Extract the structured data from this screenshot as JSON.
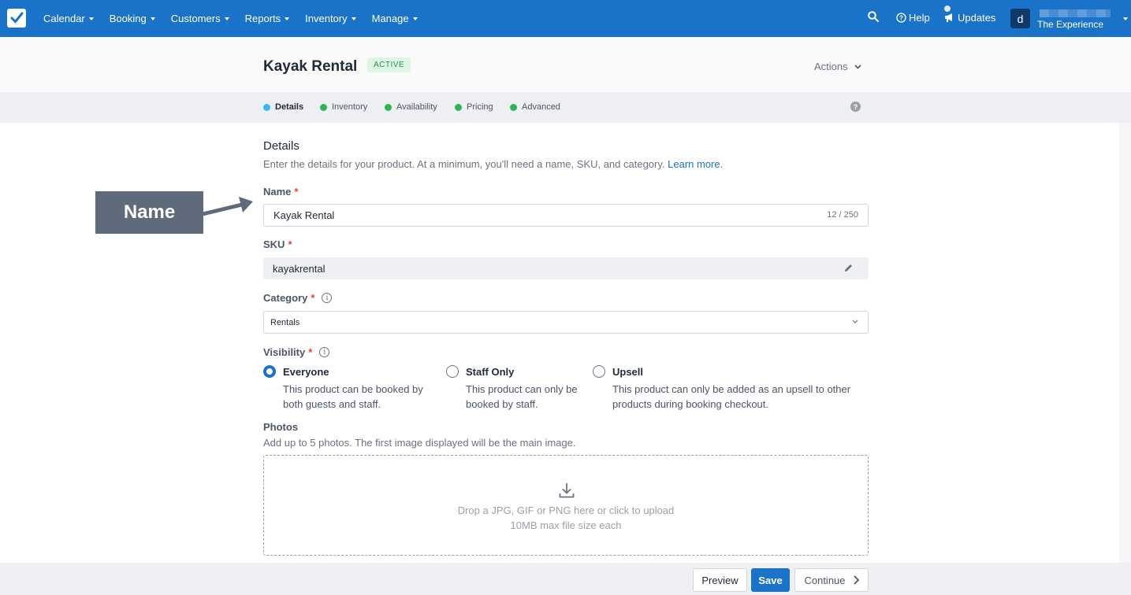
{
  "nav": {
    "items": [
      {
        "label": "Calendar",
        "name": "nav-calendar"
      },
      {
        "label": "Booking",
        "name": "nav-booking"
      },
      {
        "label": "Customers",
        "name": "nav-customers"
      },
      {
        "label": "Reports",
        "name": "nav-reports"
      },
      {
        "label": "Inventory",
        "name": "nav-inventory"
      },
      {
        "label": "Manage",
        "name": "nav-manage"
      }
    ],
    "help": "Help",
    "updates": "Updates",
    "avatar_letter": "d",
    "account_name": "The Experience"
  },
  "header": {
    "title": "Kayak Rental",
    "status": "ACTIVE",
    "actions": "Actions"
  },
  "steps": [
    {
      "label": "Details",
      "color": "#3fb6f0",
      "active": true
    },
    {
      "label": "Inventory",
      "color": "#2fb553",
      "active": false
    },
    {
      "label": "Availability",
      "color": "#2fb553",
      "active": false
    },
    {
      "label": "Pricing",
      "color": "#2fb553",
      "active": false
    },
    {
      "label": "Advanced",
      "color": "#2fb553",
      "active": false
    }
  ],
  "help_icon": "?",
  "details": {
    "title": "Details",
    "description": "Enter the details for your product. At a minimum, you'll need a name, SKU, and category.",
    "learn_more": "Learn more",
    "period": "."
  },
  "form": {
    "required_mark": "*",
    "info_icon": "i",
    "name_label": "Name",
    "name_value": "Kayak Rental",
    "name_counter": "12 / 250",
    "sku_label": "SKU",
    "sku_value": "kayakrental",
    "category_label": "Category",
    "category_value": "Rentals",
    "visibility_label": "Visibility",
    "visibility_options": [
      {
        "title": "Everyone",
        "desc_1": "This product can be booked by",
        "desc_2": "both guests and staff.",
        "checked": true
      },
      {
        "title": "Staff Only",
        "desc_1": "This product can only be",
        "desc_2": "booked by staff.",
        "checked": false
      },
      {
        "title": "Upsell",
        "desc_1": "This product can only be added as an upsell to other",
        "desc_2": "products during booking checkout.",
        "checked": false
      }
    ],
    "photos_label": "Photos",
    "photos_desc": "Add up to 5 photos. The first image displayed will be the main image.",
    "drop_line1": "Drop a JPG, GIF or PNG here or click to upload",
    "drop_line2": "10MB max file size each"
  },
  "footer": {
    "preview": "Preview",
    "save": "Save",
    "continue": "Continue"
  },
  "annotation": {
    "label": "Name"
  },
  "colors": {
    "nav_bg": "#1a73c8",
    "accent": "#1a73c8",
    "active_badge_bg": "#ddf5e3",
    "active_badge_text": "#2f8f4e"
  }
}
